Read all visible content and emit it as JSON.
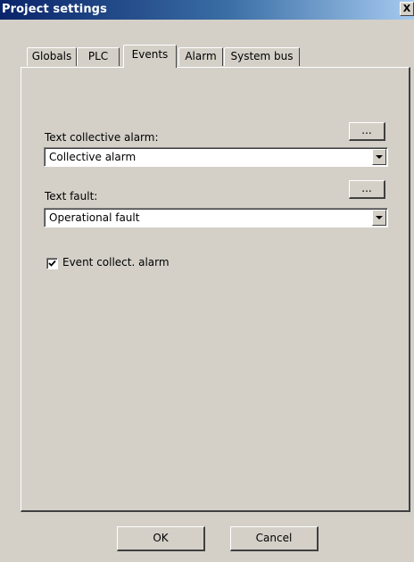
{
  "window": {
    "title": "Project settings",
    "close_glyph": "X"
  },
  "tabs": [
    {
      "label": "Globals",
      "active": false
    },
    {
      "label": "PLC",
      "active": false
    },
    {
      "label": "Events",
      "active": true
    },
    {
      "label": "Alarm",
      "active": false
    },
    {
      "label": "System bus",
      "active": false
    }
  ],
  "events": {
    "collective_alarm": {
      "label": "Text collective alarm:",
      "value": "Collective alarm",
      "browse_label": "..."
    },
    "fault": {
      "label": "Text fault:",
      "value": "Operational fault",
      "browse_label": "..."
    },
    "event_collect": {
      "label": "Event collect. alarm",
      "checked": true
    }
  },
  "footer": {
    "ok_label": "OK",
    "cancel_label": "Cancel"
  }
}
